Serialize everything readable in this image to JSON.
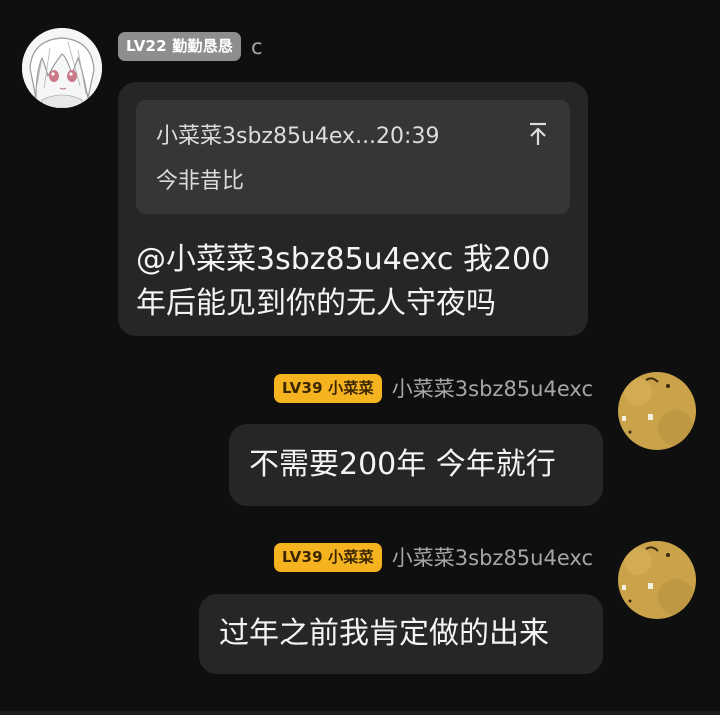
{
  "messages": [
    {
      "badge": "LV22 勤勤恳恳",
      "username": "c",
      "quote": {
        "header": "小菜菜3sbz85u4ex...20:39",
        "text": "今非昔比"
      },
      "text_line1": "@小菜菜3sbz85u4exc 我200",
      "text_line2": "年后能见到你的无人守夜吗"
    },
    {
      "badge": "LV39 小菜菜",
      "username": "小菜菜3sbz85u4exc",
      "text": "不需要200年 今年就行"
    },
    {
      "badge": "LV39 小菜菜",
      "username": "小菜菜3sbz85u4exc",
      "text": "过年之前我肯定做的出来"
    }
  ],
  "colors": {
    "background": "#0f0f0f",
    "bubble": "#262626",
    "quote_box": "#363636",
    "badge_gray": "#8e8e8e",
    "badge_gold": "#f5b320"
  },
  "icons": {
    "quote_jump": "arrow-up-to-line-icon",
    "avatar_left": "anime-girl-avatar",
    "avatar_right": "sandy-texture-avatar"
  }
}
